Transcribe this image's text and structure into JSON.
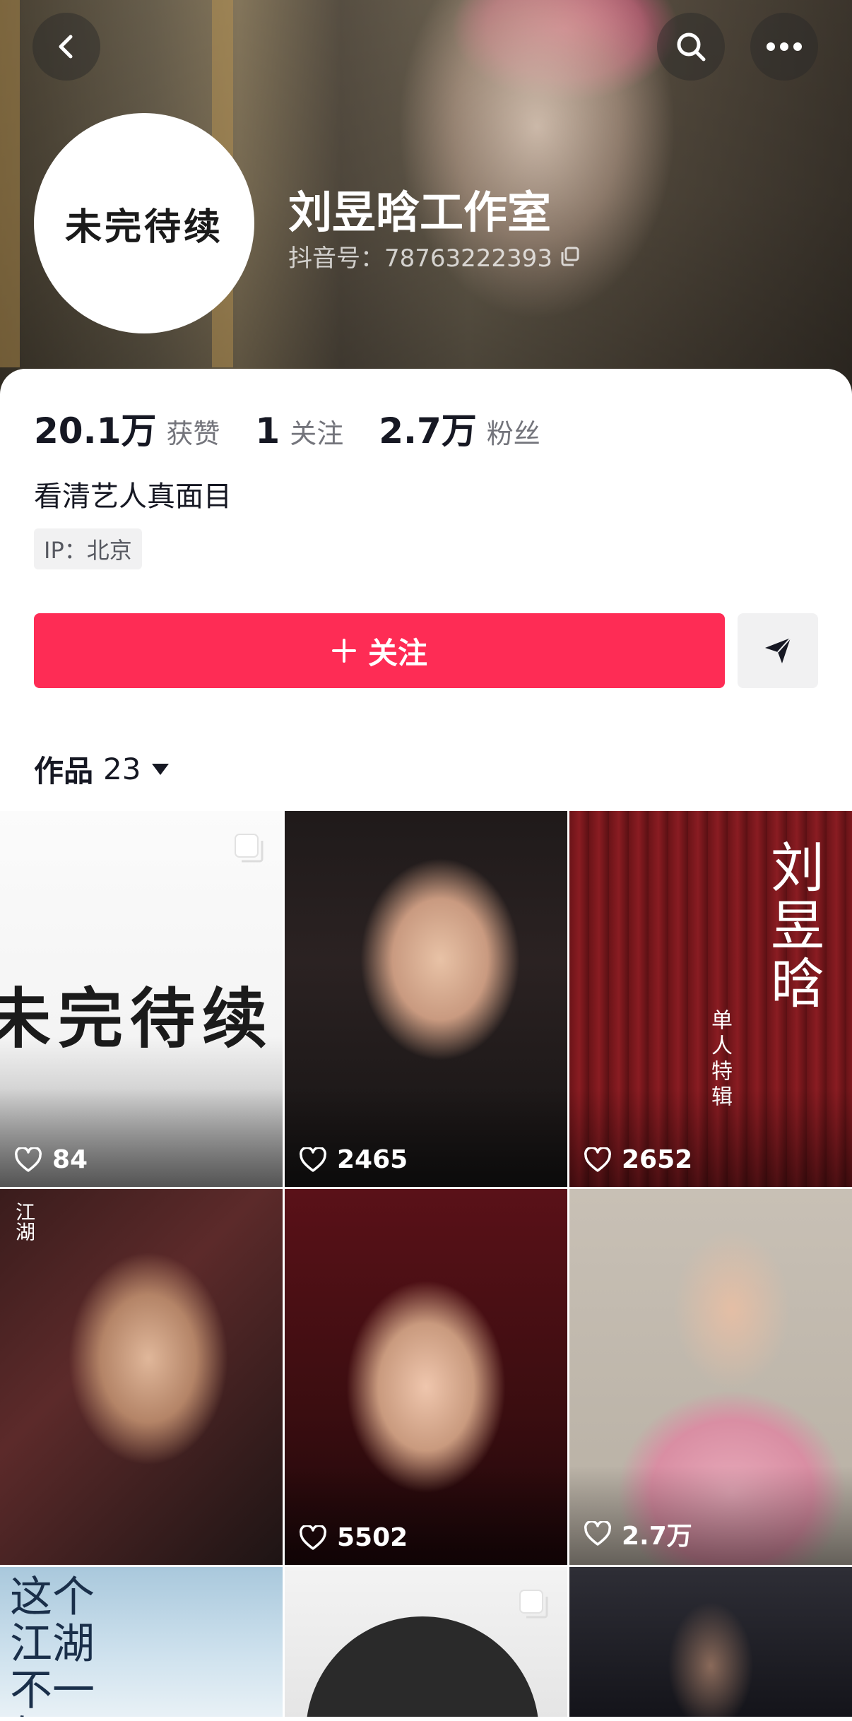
{
  "header": {
    "back_icon": "back-arrow-icon",
    "search_icon": "search-icon",
    "more_icon": "more-dots-icon"
  },
  "profile": {
    "avatar_text": "未完待续",
    "name": "刘昱晗工作室",
    "douyin_id": "抖音号：78763222393",
    "copy_icon": "copy-icon"
  },
  "stats": {
    "likes_num": "20.1万",
    "likes_label": "获赞",
    "following_num": "1",
    "following_label": "关注",
    "followers_num": "2.7万",
    "followers_label": "粉丝"
  },
  "bio": "看清艺人真面目",
  "ip": "IP：北京",
  "actions": {
    "follow_label": "关注",
    "follow_color": "#fe2c55",
    "share_icon": "send-icon"
  },
  "works_tab": {
    "label": "作品",
    "count": "23"
  },
  "videos": [
    {
      "likes": "84",
      "overlay_text": "未完待续"
    },
    {
      "likes": "2465"
    },
    {
      "likes": "2652",
      "overlay_text": "刘昱晗",
      "overlay_sub": "单人特辑"
    },
    {
      "likes": ""
    },
    {
      "likes": "5502"
    },
    {
      "likes": "2.7万"
    },
    {
      "likes": "",
      "overlay_text": "这个江湖不一般"
    },
    {
      "likes": ""
    },
    {
      "likes": ""
    }
  ]
}
